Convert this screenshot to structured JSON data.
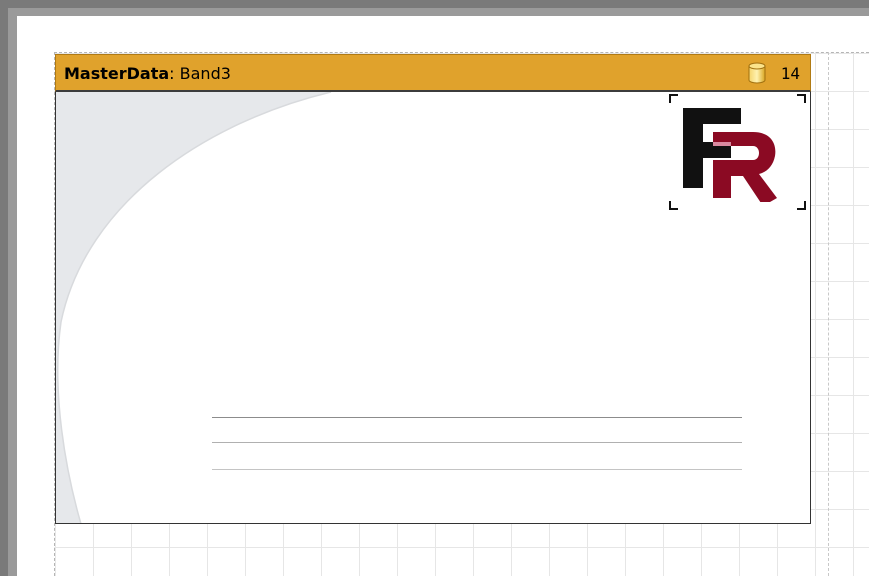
{
  "band": {
    "type_label": "MasterData",
    "separator": ": ",
    "name": "Band3",
    "count": "14",
    "icon": "database-icon"
  },
  "picture": {
    "icon": "fastreport-logo",
    "logo_text": "FR"
  },
  "colors": {
    "band_header": "#e0a22c",
    "logo_black": "#111111",
    "logo_red": "#8b0a23",
    "swoosh": "#e6e8eb"
  }
}
